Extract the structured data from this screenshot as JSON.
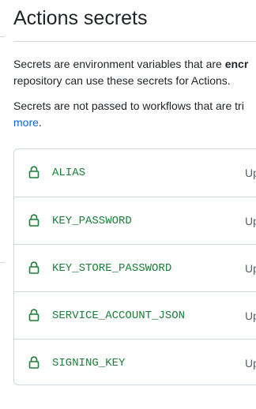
{
  "header": {
    "title": "Actions secrets"
  },
  "description": {
    "p1_line1_start": "Secrets are environment variables that are ",
    "p1_line1_bold": "encr",
    "p1_line2": "repository can use these secrets for Actions.",
    "p2_line1": "Secrets are not passed to workflows that are tri",
    "p2_link": "more",
    "p2_after_link": "."
  },
  "secrets": [
    {
      "name": "ALIAS",
      "updated": "Up"
    },
    {
      "name": "KEY_PASSWORD",
      "updated": "Up"
    },
    {
      "name": "KEY_STORE_PASSWORD",
      "updated": "Up"
    },
    {
      "name": "SERVICE_ACCOUNT_JSON",
      "updated": "Up"
    },
    {
      "name": "SIGNING_KEY",
      "updated": "Up"
    }
  ],
  "colors": {
    "secret_name": "#1a7f37",
    "link": "#0969da",
    "border": "#d0d7de",
    "muted_text": "#57606a"
  },
  "icons": {
    "secret_row": "lock-icon"
  }
}
